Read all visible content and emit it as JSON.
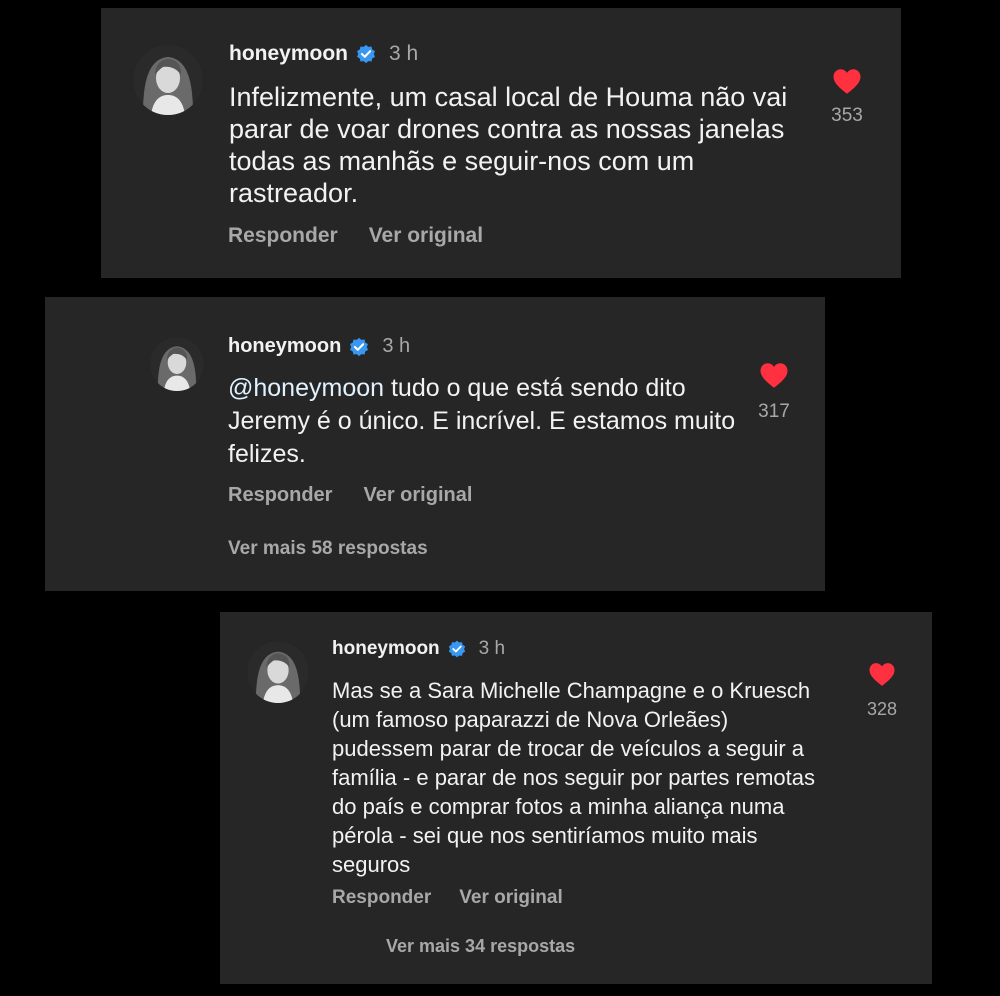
{
  "colors": {
    "background": "#000000",
    "card": "#262626",
    "text": "#f2f2f2",
    "muted": "#a8a8a8",
    "verified": "#3897f0",
    "heart": "#ff3040"
  },
  "icons": {
    "verified": "verified-badge-icon",
    "like": "heart-icon",
    "avatar": "profile-photo"
  },
  "comments": [
    {
      "username": "honeymoon",
      "time": "3 h",
      "text": "Infelizmente, um casal local de Houma não vai parar de voar drones contra as nossas janelas todas as manhãs e seguir-nos com um rastreador.",
      "likes": "353",
      "reply_label": "Responder",
      "original_label": "Ver original"
    },
    {
      "username": "honeymoon",
      "time": "3 h",
      "mention": "@honeymoon",
      "text": " tudo o que está sendo dito Jeremy é o único. E incrível. E estamos muito felizes.",
      "likes": "317",
      "reply_label": "Responder",
      "original_label": "Ver original",
      "more_replies": "Ver mais 58 respostas"
    },
    {
      "username": "honeymoon",
      "time": "3 h",
      "text": "Mas se a Sara Michelle Champagne e o Kruesch (um famoso paparazzi de Nova Orleães) pudessem parar de trocar de veículos a seguir a família - e parar de nos seguir por partes remotas do país e comprar fotos a minha aliança numa pérola - sei que nos sentiríamos muito mais seguros",
      "likes": "328",
      "reply_label": "Responder",
      "original_label": "Ver original",
      "more_replies": "Ver mais 34 respostas"
    }
  ]
}
